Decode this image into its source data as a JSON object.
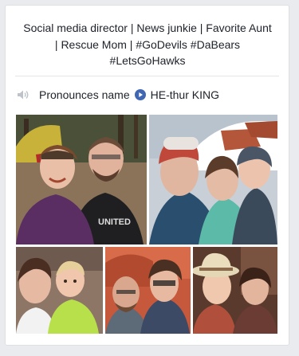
{
  "intro": {
    "bio_lines": [
      "Social media director | News junkie | Favorite Aunt",
      "| Rescue Mom | #GoDevils #DaBears",
      "#LetsGoHawks"
    ]
  },
  "pronunciation": {
    "label": "Pronounces name",
    "name": "HE-thur KING",
    "speaker_icon": "speaker-icon",
    "play_icon": "play-icon",
    "accent": "#4267b2"
  },
  "photos": {
    "count": 5,
    "shirt_text": "UNITED"
  }
}
